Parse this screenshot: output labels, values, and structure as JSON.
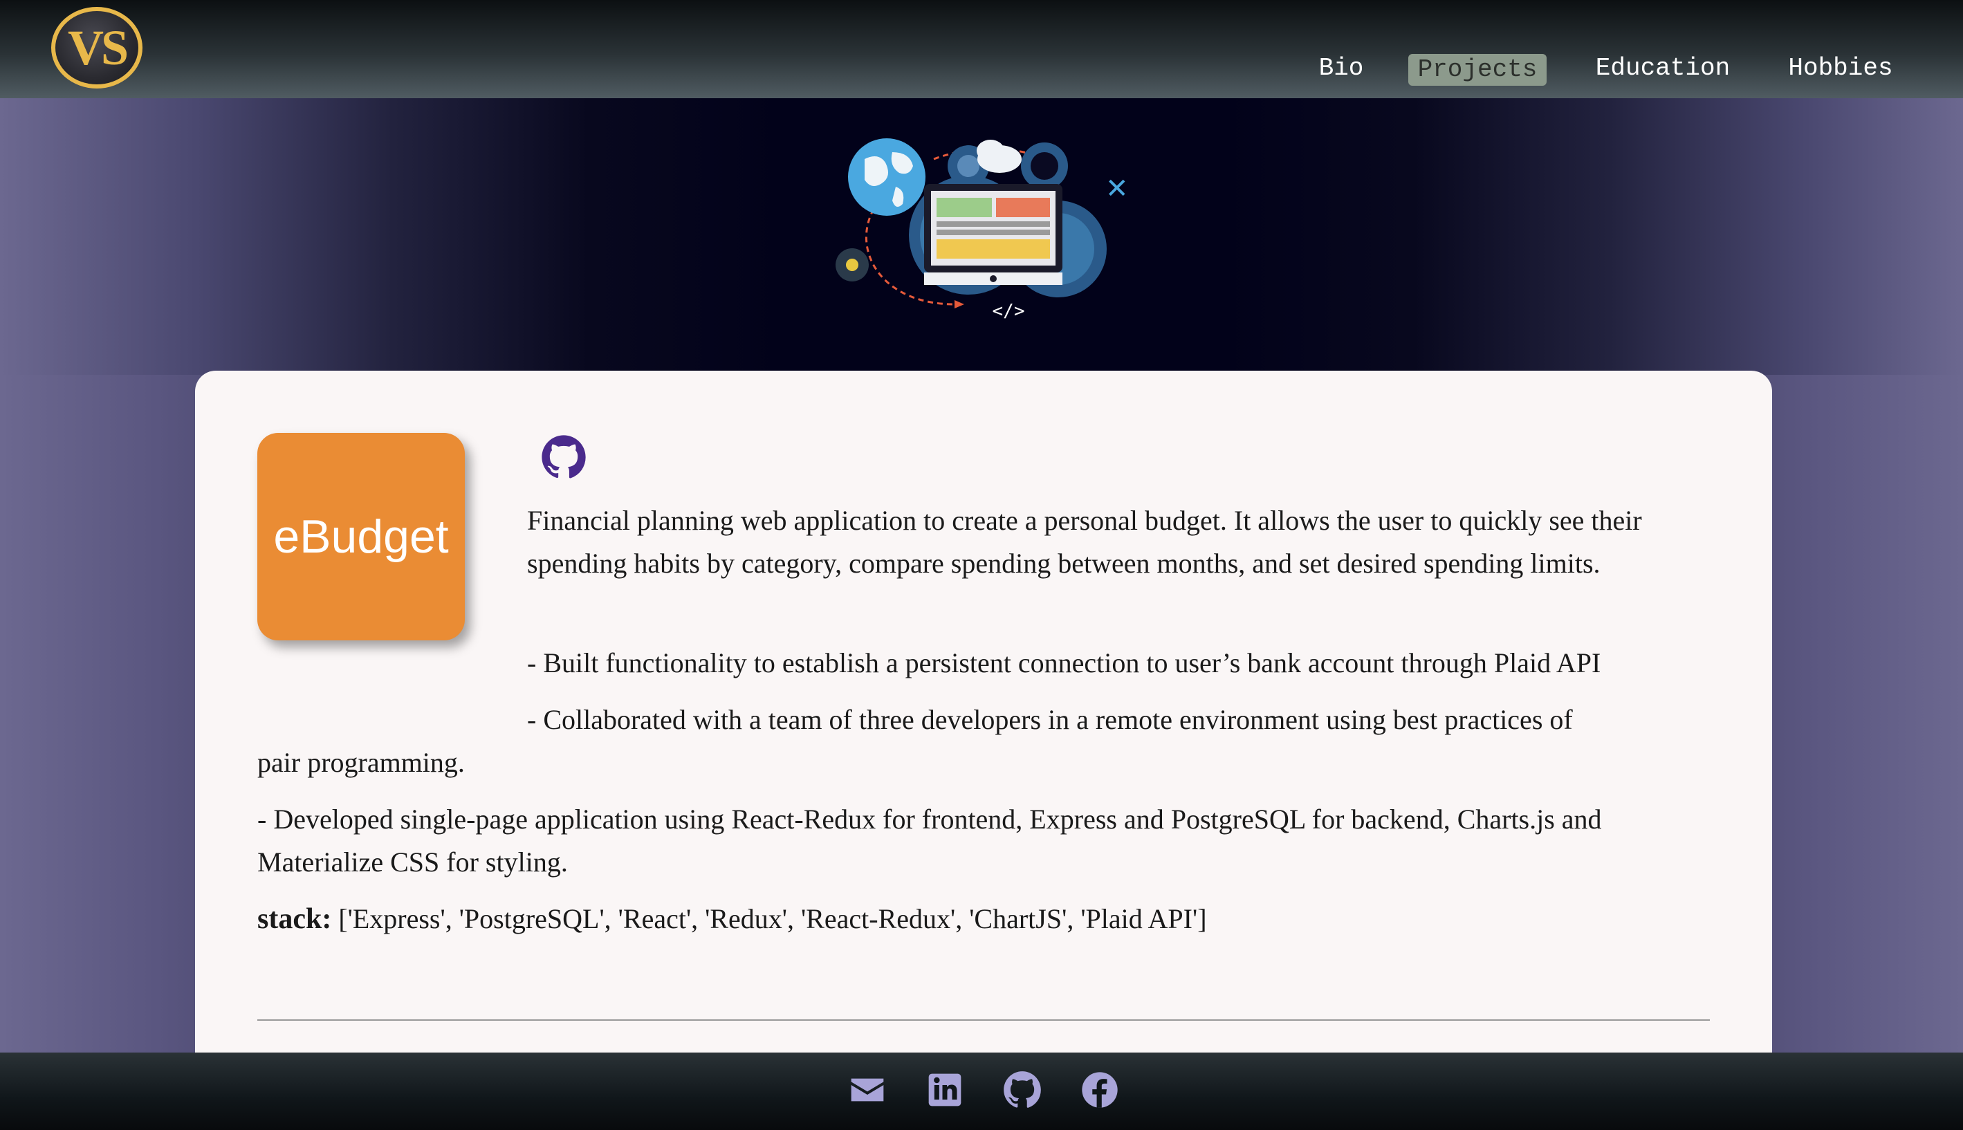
{
  "header": {
    "logo_text": "VS",
    "nav": [
      {
        "label": "Bio",
        "active": false
      },
      {
        "label": "Projects",
        "active": true
      },
      {
        "label": "Education",
        "active": false
      },
      {
        "label": "Hobbies",
        "active": false
      }
    ]
  },
  "hero": {
    "icon": "web-development-illustration",
    "code_tag": "</>"
  },
  "project": {
    "logo_text": "eBudget",
    "logo_color": "#ea8c34",
    "github_icon": "github-icon",
    "description": "Financial planning web application to create a personal budget. It allows the user to quickly see their spending habits by category, compare spending between months, and set desired spending limits.",
    "bullet_1": "- Built functionality to establish a persistent connection to user’s bank account through Plaid API",
    "bullet_2_a": "- Collaborated with a team of three developers in a remote environment using best practices of",
    "bullet_2_b": "pair programming.",
    "bullet_3": "- Developed single-page application using React-Redux for frontend, Express and PostgreSQL for backend, Charts.js and Materialize CSS for styling.",
    "stack_label": "stack:",
    "stack_value": "['Express', 'PostgreSQL', 'React', 'Redux', 'React-Redux', 'ChartJS', 'Plaid API']"
  },
  "footer": {
    "icons": [
      "mail-icon",
      "linkedin-icon",
      "github-icon",
      "facebook-icon"
    ],
    "icon_color": "#a8a4d8"
  },
  "colors": {
    "accent_gold": "#e8b84a",
    "nav_active_bg": "#8c9a8c",
    "card_bg": "#faf6f6",
    "github_purple": "#4a2a8c"
  }
}
